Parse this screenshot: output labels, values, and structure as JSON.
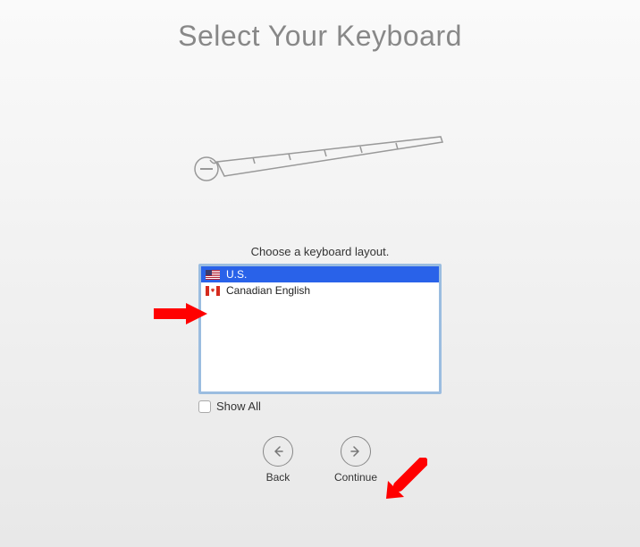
{
  "title": "Select Your Keyboard",
  "instruction": "Choose a keyboard layout.",
  "layouts": [
    {
      "label": "U.S.",
      "flag": "us",
      "selected": true
    },
    {
      "label": "Canadian English",
      "flag": "ca",
      "selected": false
    }
  ],
  "show_all": {
    "label": "Show All",
    "checked": false
  },
  "nav": {
    "back": "Back",
    "continue": "Continue"
  }
}
